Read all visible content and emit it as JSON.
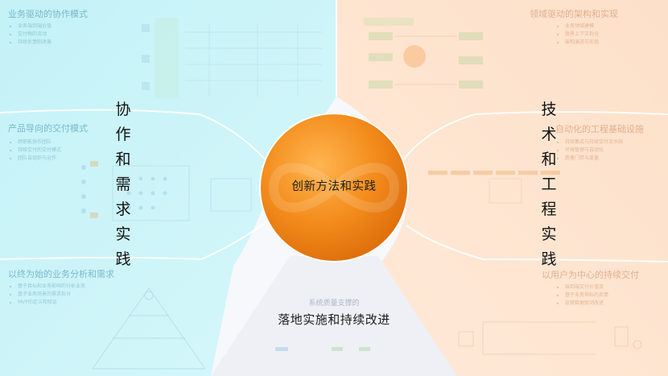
{
  "center": {
    "label": "创新方法和实践"
  },
  "bottom": {
    "subtitle": "系统质量支撑的",
    "title": "落地实施和持续改进"
  },
  "left_vertical": [
    "协",
    "作",
    "和",
    "需",
    "求",
    "实",
    "践"
  ],
  "right_vertical": [
    "技",
    "术",
    "和",
    "工",
    "程",
    "实",
    "践"
  ],
  "panels": {
    "top_left": {
      "title": "业务驱动的协作模式",
      "bullets": [
        "业务端到端价值",
        "交付物的流动",
        "持续反馈和改善"
      ]
    },
    "mid_left": {
      "title": "产品导向的交付模式",
      "bullets": [
        "跨职能协作团队",
        "持续交付的交付模式",
        "团队自组织与运作"
      ]
    },
    "bottom_left": {
      "title": "以终为始的业务分析和需求",
      "bullets": [
        "基于目标和业务影响的分析业务",
        "基于业务场景的需求拆分",
        "MVP的定义和验证"
      ]
    },
    "top_right": {
      "title": "领域驱动的架构和实现",
      "bullets": [
        "业务领域建模",
        "限界上下文拆分",
        "架构演进与实现"
      ]
    },
    "mid_right": {
      "title": "自动化的工程基础设施",
      "bullets": [
        "持续集成与持续交付流水线",
        "环境管理与自动化",
        "质量门禁与度量"
      ]
    },
    "bottom_right": {
      "title": "以用户为中心的持续交付",
      "bullets": [
        "端到端交付价值流",
        "基于业务指标的反馈",
        "运营数据驱动改进"
      ]
    }
  },
  "colors": {
    "left_panel": "#c9f4f8",
    "right_panel": "#fde2cc",
    "bottom_panel": "#eceef3",
    "center_circle": "#f08a1a",
    "panel_border": "#ffffff"
  }
}
